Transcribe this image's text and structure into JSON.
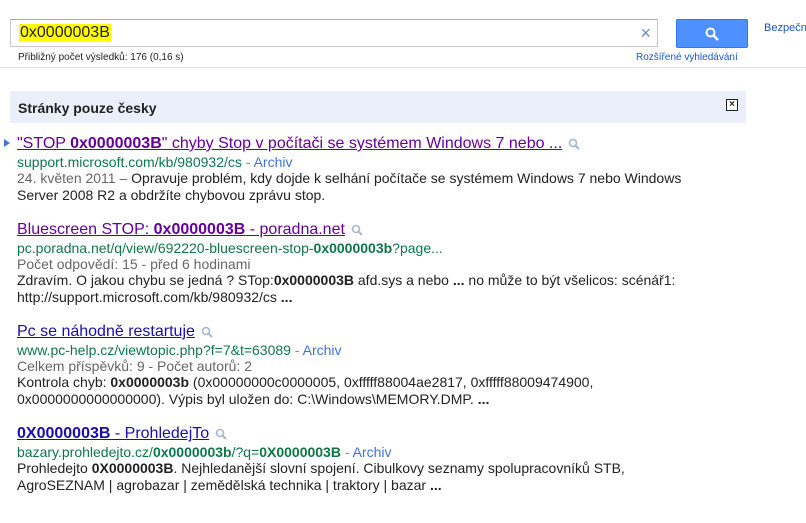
{
  "search": {
    "query": "0x0000003B",
    "clear_glyph": "×",
    "stats": "Přibližný počet výsledků: 176 (0,16 s)",
    "advanced_link": "Rozšířené vyhledávání",
    "top_link": "Bezpečné"
  },
  "filter": {
    "title": "Stránky pouze česky",
    "close_glyph": "×"
  },
  "results": [
    {
      "title_pre": "\"STOP ",
      "title_bold": "0x0000003B",
      "title_post": "\" chyby Stop v počítači se systémem Windows 7 nebo ...",
      "url_pre": "support.microsoft.com/kb/980932/cs",
      "url_bold": "",
      "url_post": "",
      "cache": "Archiv",
      "meta": "24. květen 2011 – ",
      "snippet_1": "Opravuje problém, kdy dojde k selhání počítače se systémem Windows 7 nebo Windows Server 2008 R2 a obdržíte chybovou zprávu stop."
    },
    {
      "title_pre": "Bluescreen STOP: ",
      "title_bold": "0x0000003B",
      "title_post": " - poradna.net",
      "url_pre": "pc.poradna.net/q/view/692220-bluescreen-stop-",
      "url_bold": "0x0000003b",
      "url_post": "?page...",
      "cache": "",
      "meta": "Počet odpovědí: 15 - před 6 hodinami",
      "snippet_a": "Zdravím. O jakou chybu se jedná ? STop:",
      "snippet_b": "0x0000003B",
      "snippet_c": " afd.sys a nebo ",
      "snippet_d": "...",
      "snippet_e": " no může to být všelicos: scénář1: http://support.microsoft.com/kb/980932/cs ",
      "snippet_f": "..."
    },
    {
      "title_pre": "Pc se náhodně restartuje",
      "url_pre": "www.pc-help.cz/viewtopic.php?f=7&t=63089",
      "cache": "Archiv",
      "meta": "Celkem příspěvků: 9 - Počet autorů: 2",
      "snippet_a": "Kontrola chyb: ",
      "snippet_b": "0x0000003b",
      "snippet_c": " (0x00000000c0000005, 0xfffff88004ae2817, 0xfffff88009474900, 0x0000000000000000). Výpis byl uložen do: C:\\Windows\\MEMORY.DMP. ",
      "snippet_d": "..."
    },
    {
      "title_bold": "0X0000003B",
      "title_post": " - ProhledejTo",
      "url_pre": "bazary.prohledejto.cz/",
      "url_bold": "0x0000003b",
      "url_post": "/?q=",
      "url_bold2": "0X0000003B",
      "cache": "Archiv",
      "snippet_a": "Prohledejto ",
      "snippet_b": "0X0000003B",
      "snippet_c": ". Nejhledanější slovní spojení. Cibulkovy seznamy spolupracovníků STB, AgroSEZNAM | agrobazar | zemědělská technika | traktory | bazar ",
      "snippet_d": "..."
    }
  ],
  "separator": " - ",
  "colors": {
    "accent": "#4d90fe",
    "link": "#1a0dab",
    "visited": "#660099",
    "url": "#0e774a",
    "highlight": "#ffff00",
    "filter_bg": "#ebeff9"
  }
}
